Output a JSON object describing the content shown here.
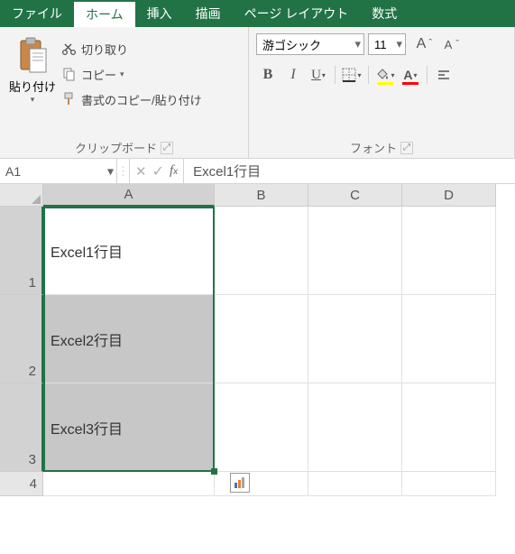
{
  "tabs": {
    "file": "ファイル",
    "home": "ホーム",
    "insert": "挿入",
    "draw": "描画",
    "layout": "ページ レイアウト",
    "formulas": "数式"
  },
  "ribbon": {
    "paste": "貼り付け",
    "cut": "切り取り",
    "copy": "コピー",
    "format_painter": "書式のコピー/貼り付け",
    "clipboard_group": "クリップボード",
    "font_group": "フォント",
    "font_name": "游ゴシック",
    "font_size": "11"
  },
  "namebox": "A1",
  "formula": "Excel1行目",
  "columns": [
    "A",
    "B",
    "C",
    "D"
  ],
  "rows": [
    "1",
    "2",
    "3",
    "4"
  ],
  "cells": {
    "A1": "Excel1行目",
    "A2": "Excel2行目",
    "A3": "Excel3行目"
  }
}
